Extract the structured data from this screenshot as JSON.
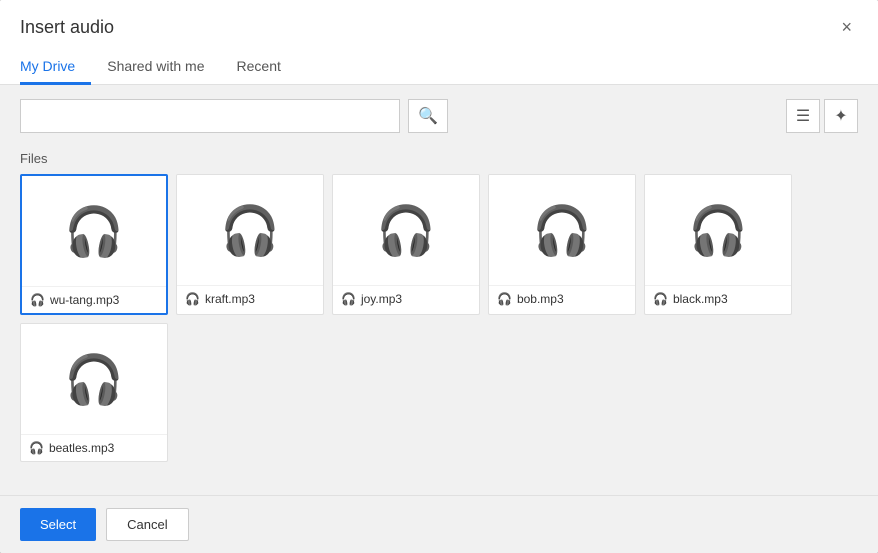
{
  "dialog": {
    "title": "Insert audio",
    "close_label": "×"
  },
  "tabs": [
    {
      "id": "my-drive",
      "label": "My Drive",
      "active": true
    },
    {
      "id": "shared-with-me",
      "label": "Shared with me",
      "active": false
    },
    {
      "id": "recent",
      "label": "Recent",
      "active": false
    }
  ],
  "search": {
    "placeholder": "",
    "value": ""
  },
  "section_label": "Files",
  "files": [
    {
      "name": "wu-tang.mp3",
      "selected": true
    },
    {
      "name": "kraft.mp3",
      "selected": false
    },
    {
      "name": "joy.mp3",
      "selected": false
    },
    {
      "name": "bob.mp3",
      "selected": false
    },
    {
      "name": "black.mp3",
      "selected": false
    },
    {
      "name": "beatles.mp3",
      "selected": false
    }
  ],
  "footer": {
    "select_label": "Select",
    "cancel_label": "Cancel"
  }
}
